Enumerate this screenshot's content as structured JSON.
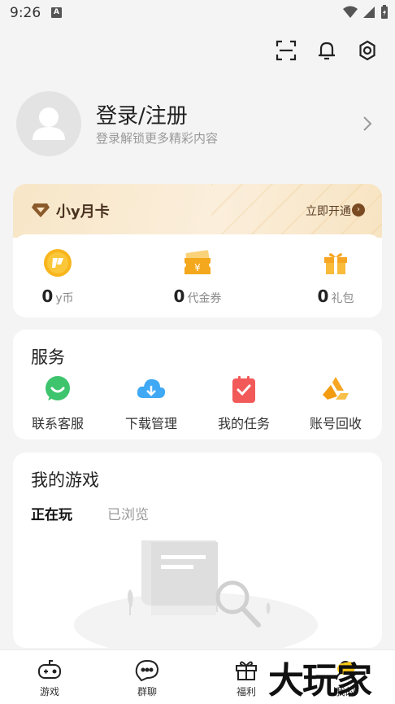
{
  "status_bar": {
    "time": "9:26",
    "notification_letter": "A"
  },
  "top_icons": [
    "scan-icon",
    "bell-icon",
    "gear-icon"
  ],
  "profile": {
    "title": "登录/注册",
    "subtitle": "登录解锁更多精彩内容"
  },
  "vip": {
    "title": "小y月卡",
    "open_label": "立即开通",
    "stats": [
      {
        "icon": "y-coin-icon",
        "value": "0",
        "label": "y币"
      },
      {
        "icon": "voucher-icon",
        "value": "0",
        "label": "代金券"
      },
      {
        "icon": "gift-icon",
        "value": "0",
        "label": "礼包"
      }
    ]
  },
  "services": {
    "title": "服务",
    "items": [
      {
        "icon": "chat-icon",
        "label": "联系客服"
      },
      {
        "icon": "download-icon",
        "label": "下载管理"
      },
      {
        "icon": "task-icon",
        "label": "我的任务"
      },
      {
        "icon": "recycle-icon",
        "label": "账号回收"
      }
    ]
  },
  "my_games": {
    "title": "我的游戏",
    "tabs": [
      "正在玩",
      "已浏览"
    ]
  },
  "bottom_nav": [
    {
      "icon": "gamepad-icon",
      "label": "游戏"
    },
    {
      "icon": "group-chat-icon",
      "label": "群聊"
    },
    {
      "icon": "welfare-gift-icon",
      "label": "福利"
    },
    {
      "icon": "profile-icon",
      "label": "我的"
    }
  ],
  "watermark": "大玩家",
  "colors": {
    "accent_yellow": "#f9d84a",
    "vip_brown": "#7a4a22",
    "green": "#3ec46d",
    "blue": "#3fa9f5",
    "red": "#f25a5a",
    "orange": "#f6a623"
  }
}
